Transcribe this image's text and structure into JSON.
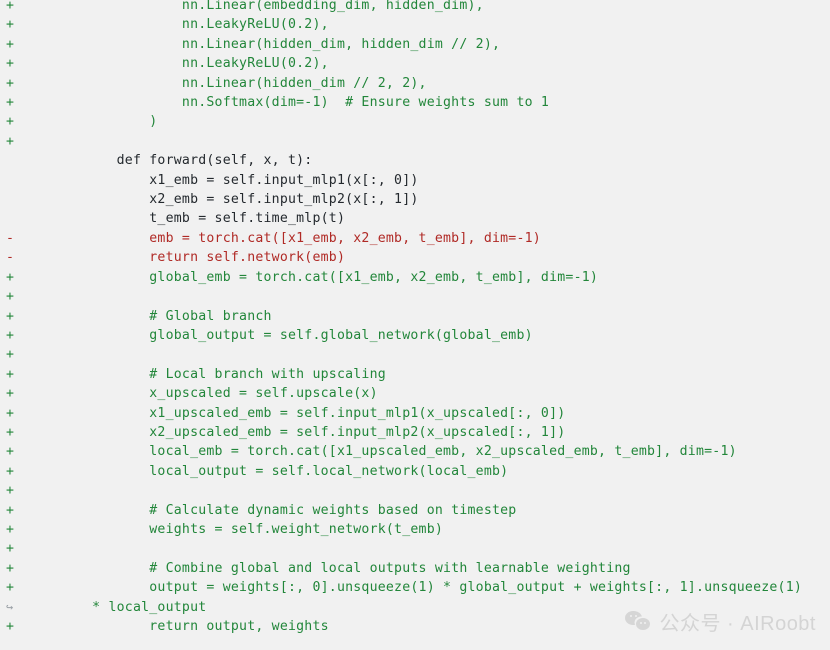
{
  "viewer": {
    "background_color": "#f1f1f1",
    "added_color": "#22863a",
    "removed_color": "#b02a26",
    "context_color": "#24292e",
    "add_marker": "+",
    "del_marker": "-",
    "wrap_marker": "↪"
  },
  "diff": {
    "lines": [
      {
        "type": "add",
        "marker": "+",
        "code": "            nn.Linear(embedding_dim, hidden_dim),"
      },
      {
        "type": "add",
        "marker": "+",
        "code": "            nn.LeakyReLU(0.2),"
      },
      {
        "type": "add",
        "marker": "+",
        "code": "            nn.Linear(hidden_dim, hidden_dim // 2),"
      },
      {
        "type": "add",
        "marker": "+",
        "code": "            nn.LeakyReLU(0.2),"
      },
      {
        "type": "add",
        "marker": "+",
        "code": "            nn.Linear(hidden_dim // 2, 2),"
      },
      {
        "type": "add",
        "marker": "+",
        "code": "            nn.Softmax(dim=-1)  # Ensure weights sum to 1"
      },
      {
        "type": "add",
        "marker": "+",
        "code": "        )"
      },
      {
        "type": "add",
        "marker": "+",
        "code": ""
      },
      {
        "type": "ctx",
        "marker": "",
        "code": "    def forward(self, x, t):"
      },
      {
        "type": "ctx",
        "marker": "",
        "code": "        x1_emb = self.input_mlp1(x[:, 0])"
      },
      {
        "type": "ctx",
        "marker": "",
        "code": "        x2_emb = self.input_mlp2(x[:, 1])"
      },
      {
        "type": "ctx",
        "marker": "",
        "code": "        t_emb = self.time_mlp(t)"
      },
      {
        "type": "del",
        "marker": "-",
        "code": "        emb = torch.cat([x1_emb, x2_emb, t_emb], dim=-1)"
      },
      {
        "type": "del",
        "marker": "-",
        "code": "        return self.network(emb)"
      },
      {
        "type": "add",
        "marker": "+",
        "code": "        global_emb = torch.cat([x1_emb, x2_emb, t_emb], dim=-1)"
      },
      {
        "type": "add",
        "marker": "+",
        "code": ""
      },
      {
        "type": "add",
        "marker": "+",
        "code": "        # Global branch"
      },
      {
        "type": "add",
        "marker": "+",
        "code": "        global_output = self.global_network(global_emb)"
      },
      {
        "type": "add",
        "marker": "+",
        "code": ""
      },
      {
        "type": "add",
        "marker": "+",
        "code": "        # Local branch with upscaling"
      },
      {
        "type": "add",
        "marker": "+",
        "code": "        x_upscaled = self.upscale(x)"
      },
      {
        "type": "add",
        "marker": "+",
        "code": "        x1_upscaled_emb = self.input_mlp1(x_upscaled[:, 0])"
      },
      {
        "type": "add",
        "marker": "+",
        "code": "        x2_upscaled_emb = self.input_mlp2(x_upscaled[:, 1])"
      },
      {
        "type": "add",
        "marker": "+",
        "code": "        local_emb = torch.cat([x1_upscaled_emb, x2_upscaled_emb, t_emb], dim=-1)"
      },
      {
        "type": "add",
        "marker": "+",
        "code": "        local_output = self.local_network(local_emb)"
      },
      {
        "type": "add",
        "marker": "+",
        "code": ""
      },
      {
        "type": "add",
        "marker": "+",
        "code": "        # Calculate dynamic weights based on timestep"
      },
      {
        "type": "add",
        "marker": "+",
        "code": "        weights = self.weight_network(t_emb)"
      },
      {
        "type": "add",
        "marker": "+",
        "code": ""
      },
      {
        "type": "add",
        "marker": "+",
        "code": "        # Combine global and local outputs with learnable weighting"
      },
      {
        "type": "add",
        "marker": "+",
        "code": "        output = weights[:, 0].unsqueeze(1) * global_output + weights[:, 1].unsqueeze(1)"
      },
      {
        "type": "wrap",
        "marker": "↪",
        "code": " * local_output"
      },
      {
        "type": "add",
        "marker": "+",
        "code": "        return output, weights"
      }
    ]
  },
  "watermark": {
    "logo_name": "wechat-logo",
    "text": "公众号 · AIRoobt"
  }
}
